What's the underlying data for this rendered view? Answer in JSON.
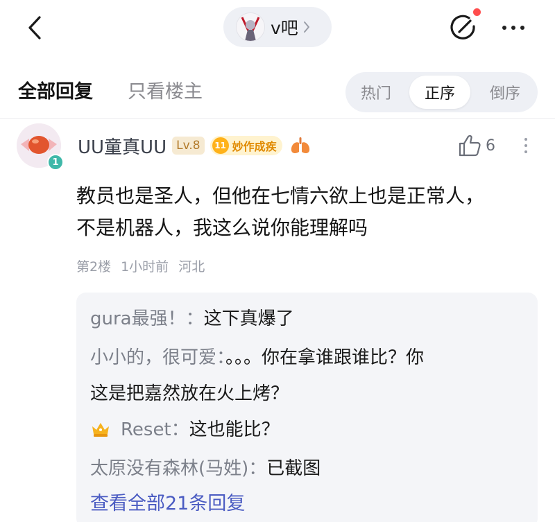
{
  "topbar": {
    "forum_name": "v吧"
  },
  "filters": {
    "all_replies": "全部回复",
    "op_only": "只看楼主",
    "sort_hot": "热门",
    "sort_asc": "正序",
    "sort_desc": "倒序"
  },
  "post": {
    "author": "UU童真UU",
    "avatar_badge": "1",
    "level": "Lv.8",
    "title_level": "11",
    "title": "妙作成疾",
    "likes": "6",
    "content_line1": "教员也是圣人，但他在七情六欲上也是正常人，",
    "content_line2": "不是机器人，我这么说你能理解吗",
    "floor": "第2楼",
    "time": "1小时前",
    "location": "河北"
  },
  "replies": [
    {
      "name": "gura最强！：",
      "text": "这下真爆了"
    },
    {
      "name": "小小的，很可爱：",
      "text": "。。。你在拿谁跟谁比？你",
      "text2": "这是把嘉然放在火上烤？"
    },
    {
      "name": "Reset：",
      "text": "这也能比？"
    },
    {
      "name": "太原没有森林(马姓)：",
      "text": "已截图"
    }
  ],
  "view_all": "查看全部21条回复",
  "colors": {
    "accent_link": "#4a5bc2",
    "level_badge": "#b27a2a",
    "title_badge": "#e08a00",
    "notify_dot": "#ff4d4d"
  },
  "icons": [
    "back-arrow-icon",
    "chevron-right-icon",
    "share-icon",
    "more-icon",
    "thumbs-up-icon",
    "lung-icon",
    "crown-icon"
  ]
}
